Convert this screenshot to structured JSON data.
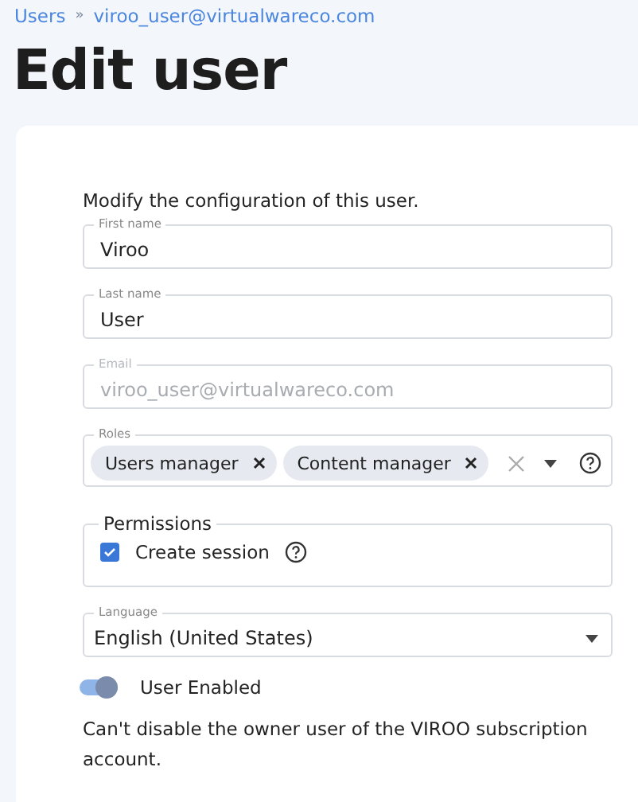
{
  "breadcrumb": {
    "items": [
      "Users",
      "viroo_user@virtualwareco.com"
    ],
    "separator": "»"
  },
  "title": "Edit user",
  "description": "Modify the configuration of this user.",
  "fields": [
    {
      "label": "First name",
      "value": "Viroo",
      "disabled": false
    },
    {
      "label": "Last name",
      "value": "User",
      "disabled": false
    },
    {
      "label": "Email",
      "value": "viroo_user@virtualwareco.com",
      "disabled": true
    }
  ],
  "roles": {
    "label": "Roles",
    "chips": [
      "Users manager",
      "Content manager"
    ]
  },
  "permissions": {
    "legend": "Permissions",
    "items": [
      {
        "label": "Create session",
        "checked": true
      }
    ]
  },
  "language": {
    "label": "Language",
    "value": "English (United States)"
  },
  "toggle": {
    "label": "User Enabled",
    "on": true
  },
  "note": "Can't disable the owner user of the VIROO subscription account."
}
